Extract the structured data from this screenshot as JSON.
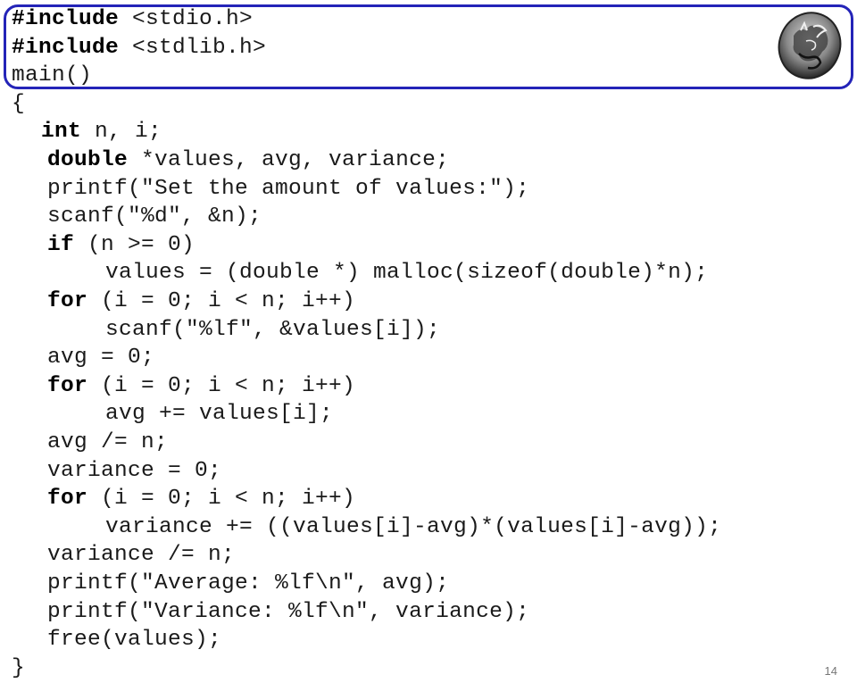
{
  "slide": {
    "page_number": "14",
    "logo": "university-coin-emblem"
  },
  "code": {
    "lines": [
      {
        "indent": 0,
        "kw": "#include",
        "rest": " <stdio.h>"
      },
      {
        "indent": 0,
        "kw": "#include",
        "rest": " <stdlib.h>"
      },
      {
        "indent": 0,
        "kw": "",
        "rest": "main()"
      },
      {
        "indent": 0,
        "kw": "",
        "rest": "{"
      },
      {
        "indent": 1,
        "kw": "int",
        "rest": " n, i;"
      },
      {
        "indent": 1,
        "kw": "double",
        "rest": " *values, avg, variance;"
      },
      {
        "indent": 1,
        "kw": "",
        "rest": "printf(\"Set the amount of values:\");"
      },
      {
        "indent": 1,
        "kw": "",
        "rest": "scanf(\"%d\", &n);"
      },
      {
        "indent": 1,
        "kw": "if",
        "rest": " (n >= 0)"
      },
      {
        "indent": 2,
        "kw": "",
        "rest": "values = (double *) malloc(sizeof(double)*n);"
      },
      {
        "indent": 1,
        "kw": "for",
        "rest": " (i = 0; i < n; i++)"
      },
      {
        "indent": 2,
        "kw": "",
        "rest": "scanf(\"%lf\", &values[i]);"
      },
      {
        "indent": 1,
        "kw": "",
        "rest": "avg = 0;"
      },
      {
        "indent": 1,
        "kw": "for",
        "rest": " (i = 0; i < n; i++)"
      },
      {
        "indent": 2,
        "kw": "",
        "rest": "avg += values[i];"
      },
      {
        "indent": 1,
        "kw": "",
        "rest": "avg /= n;"
      },
      {
        "indent": 1,
        "kw": "",
        "rest": "variance = 0;"
      },
      {
        "indent": 1,
        "kw": "for",
        "rest": " (i = 0; i < n; i++)"
      },
      {
        "indent": 2,
        "kw": "",
        "rest": "variance += ((values[i]-avg)*(values[i]-avg));"
      },
      {
        "indent": 1,
        "kw": "",
        "rest": "variance /= n;"
      },
      {
        "indent": 1,
        "kw": "",
        "rest": "printf(\"Average: %lf\\n\", avg);"
      },
      {
        "indent": 1,
        "kw": "",
        "rest": "printf(\"Variance: %lf\\n\", variance);"
      },
      {
        "indent": 1,
        "kw": "",
        "rest": "free(values);"
      },
      {
        "indent": 0,
        "kw": "",
        "rest": "}"
      }
    ]
  },
  "colors": {
    "header_border": "#2424b8",
    "text": "#1a1a1a",
    "page_number": "#777777"
  }
}
